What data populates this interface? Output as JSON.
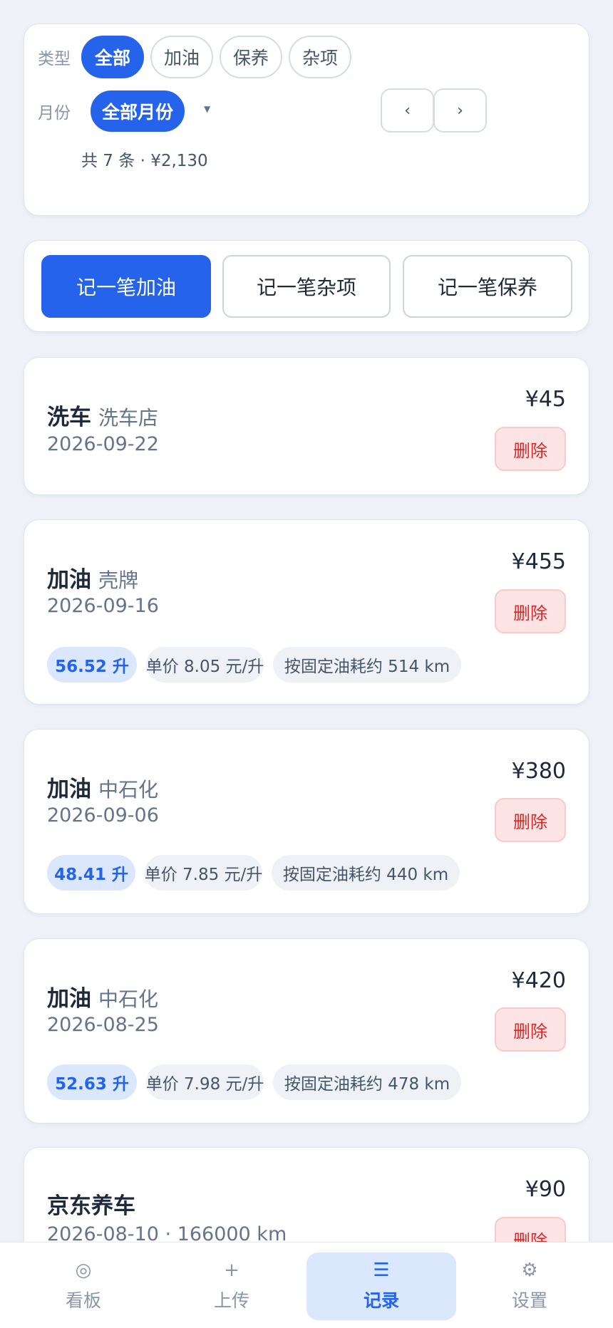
{
  "filter": {
    "type_label": "类型",
    "type_options": [
      "全部",
      "加油",
      "保养",
      "杂项"
    ],
    "month_label": "月份",
    "month_selected": "全部月份",
    "prev_label": "‹",
    "next_label": "›",
    "summary": "共 7 条 · ¥2,130"
  },
  "actions": {
    "fuel": "记一笔加油",
    "misc": "记一笔杂项",
    "maintenance": "记一笔保养"
  },
  "delete_label": "删除",
  "records": [
    {
      "title": "洗车",
      "sub": "洗车店",
      "date": "2026-09-22",
      "amount": "¥45"
    },
    {
      "title": "加油",
      "sub": "壳牌",
      "date": "2026-09-16",
      "amount": "¥455",
      "chips": [
        "56.52 升",
        "单价 8.05 元/升",
        "按固定油耗约 514 km"
      ]
    },
    {
      "title": "加油",
      "sub": "中石化",
      "date": "2026-09-06",
      "amount": "¥380",
      "chips": [
        "48.41 升",
        "单价 7.85 元/升",
        "按固定油耗约 440 km"
      ]
    },
    {
      "title": "加油",
      "sub": "中石化",
      "date": "2026-08-25",
      "amount": "¥420",
      "chips": [
        "52.63 升",
        "单价 7.98 元/升",
        "按固定油耗约 478 km"
      ]
    },
    {
      "title": "京东养车",
      "sub": "",
      "date": "2026-08-10 · 166000 km",
      "amount": "¥90"
    }
  ],
  "nav": [
    {
      "icon": "◎",
      "icon_name": "dashboard-icon",
      "label": "看板"
    },
    {
      "icon": "+",
      "icon_name": "plus-icon",
      "label": "上传"
    },
    {
      "icon": "☰",
      "icon_name": "list-icon",
      "label": "记录"
    },
    {
      "icon": "⚙",
      "icon_name": "gear-icon",
      "label": "设置"
    }
  ],
  "colors": {
    "accent": "#2563eb",
    "danger": "#dc2626",
    "background": "#eef2f8"
  }
}
